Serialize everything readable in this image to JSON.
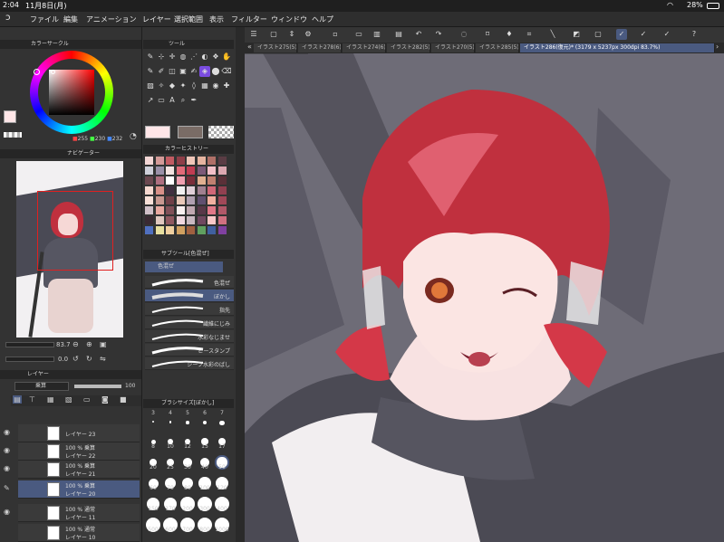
{
  "status": {
    "time": "2:04",
    "date": "11月8日(月)",
    "battery": "28%"
  },
  "menu": [
    "ファイル",
    "編集",
    "アニメーション",
    "レイヤー",
    "選択範囲",
    "表示",
    "フィルター",
    "ウィンドウ",
    "ヘルプ"
  ],
  "panels": {
    "color_circle": "カラーサークル",
    "tool": "ツール",
    "navigator": "ナビゲーター",
    "color_history": "カラーヒストリー",
    "subtool": "サブツール[色混ぜ]",
    "subtool_group": "色混ぜ",
    "layer": "レイヤー",
    "brush_size": "ブラシサイズ[ぼかし]"
  },
  "color_values": {
    "r": "255",
    "g": "230",
    "b": "232"
  },
  "navigator": {
    "zoom": "83.7",
    "angle": "0.0"
  },
  "layer_props": {
    "blend": "乗算",
    "opacity": "100"
  },
  "layers": [
    {
      "pct": "",
      "mode": "",
      "name": "レイヤー 23"
    },
    {
      "pct": "100 %",
      "mode": "乗算",
      "name": "レイヤー 22"
    },
    {
      "pct": "100 %",
      "mode": "乗算",
      "name": "レイヤー 21"
    },
    {
      "pct": "100 %",
      "mode": "乗算",
      "name": "レイヤー 20"
    },
    {
      "pct": "100 %",
      "mode": "通常",
      "name": "レイヤー 11"
    },
    {
      "pct": "100 %",
      "mode": "通常",
      "name": "レイヤー 10"
    }
  ],
  "brushes": [
    "色混ぜ",
    "ぼかし",
    "指先",
    "繊維にじみ",
    "水彩なじませ",
    "ピースタンプ",
    "ジーブ水彩のばし"
  ],
  "brush_sizes": [
    "3",
    "4",
    "5",
    "6",
    "7",
    "8",
    "10",
    "12",
    "15",
    "17",
    "20",
    "25",
    "30",
    "40",
    "50",
    "60",
    "70",
    "80",
    "100",
    "120",
    "150",
    "170",
    "200",
    "300",
    "400",
    "500",
    "600",
    "700",
    "800",
    "1000"
  ],
  "tabs": [
    "イラスト275(5)",
    "イラスト278(6)",
    "イラスト274(6)",
    "イラスト282(5)",
    "イラスト270(5)",
    "イラスト285(5)",
    "イラスト286(復元)* (3179 x 5237px 300dpi 83.7%)"
  ],
  "colors": {
    "fg": "#ffe6e8",
    "canvas_bg": "#6e6c77",
    "hair": "#c0303e",
    "accent": "#4a5a80"
  }
}
